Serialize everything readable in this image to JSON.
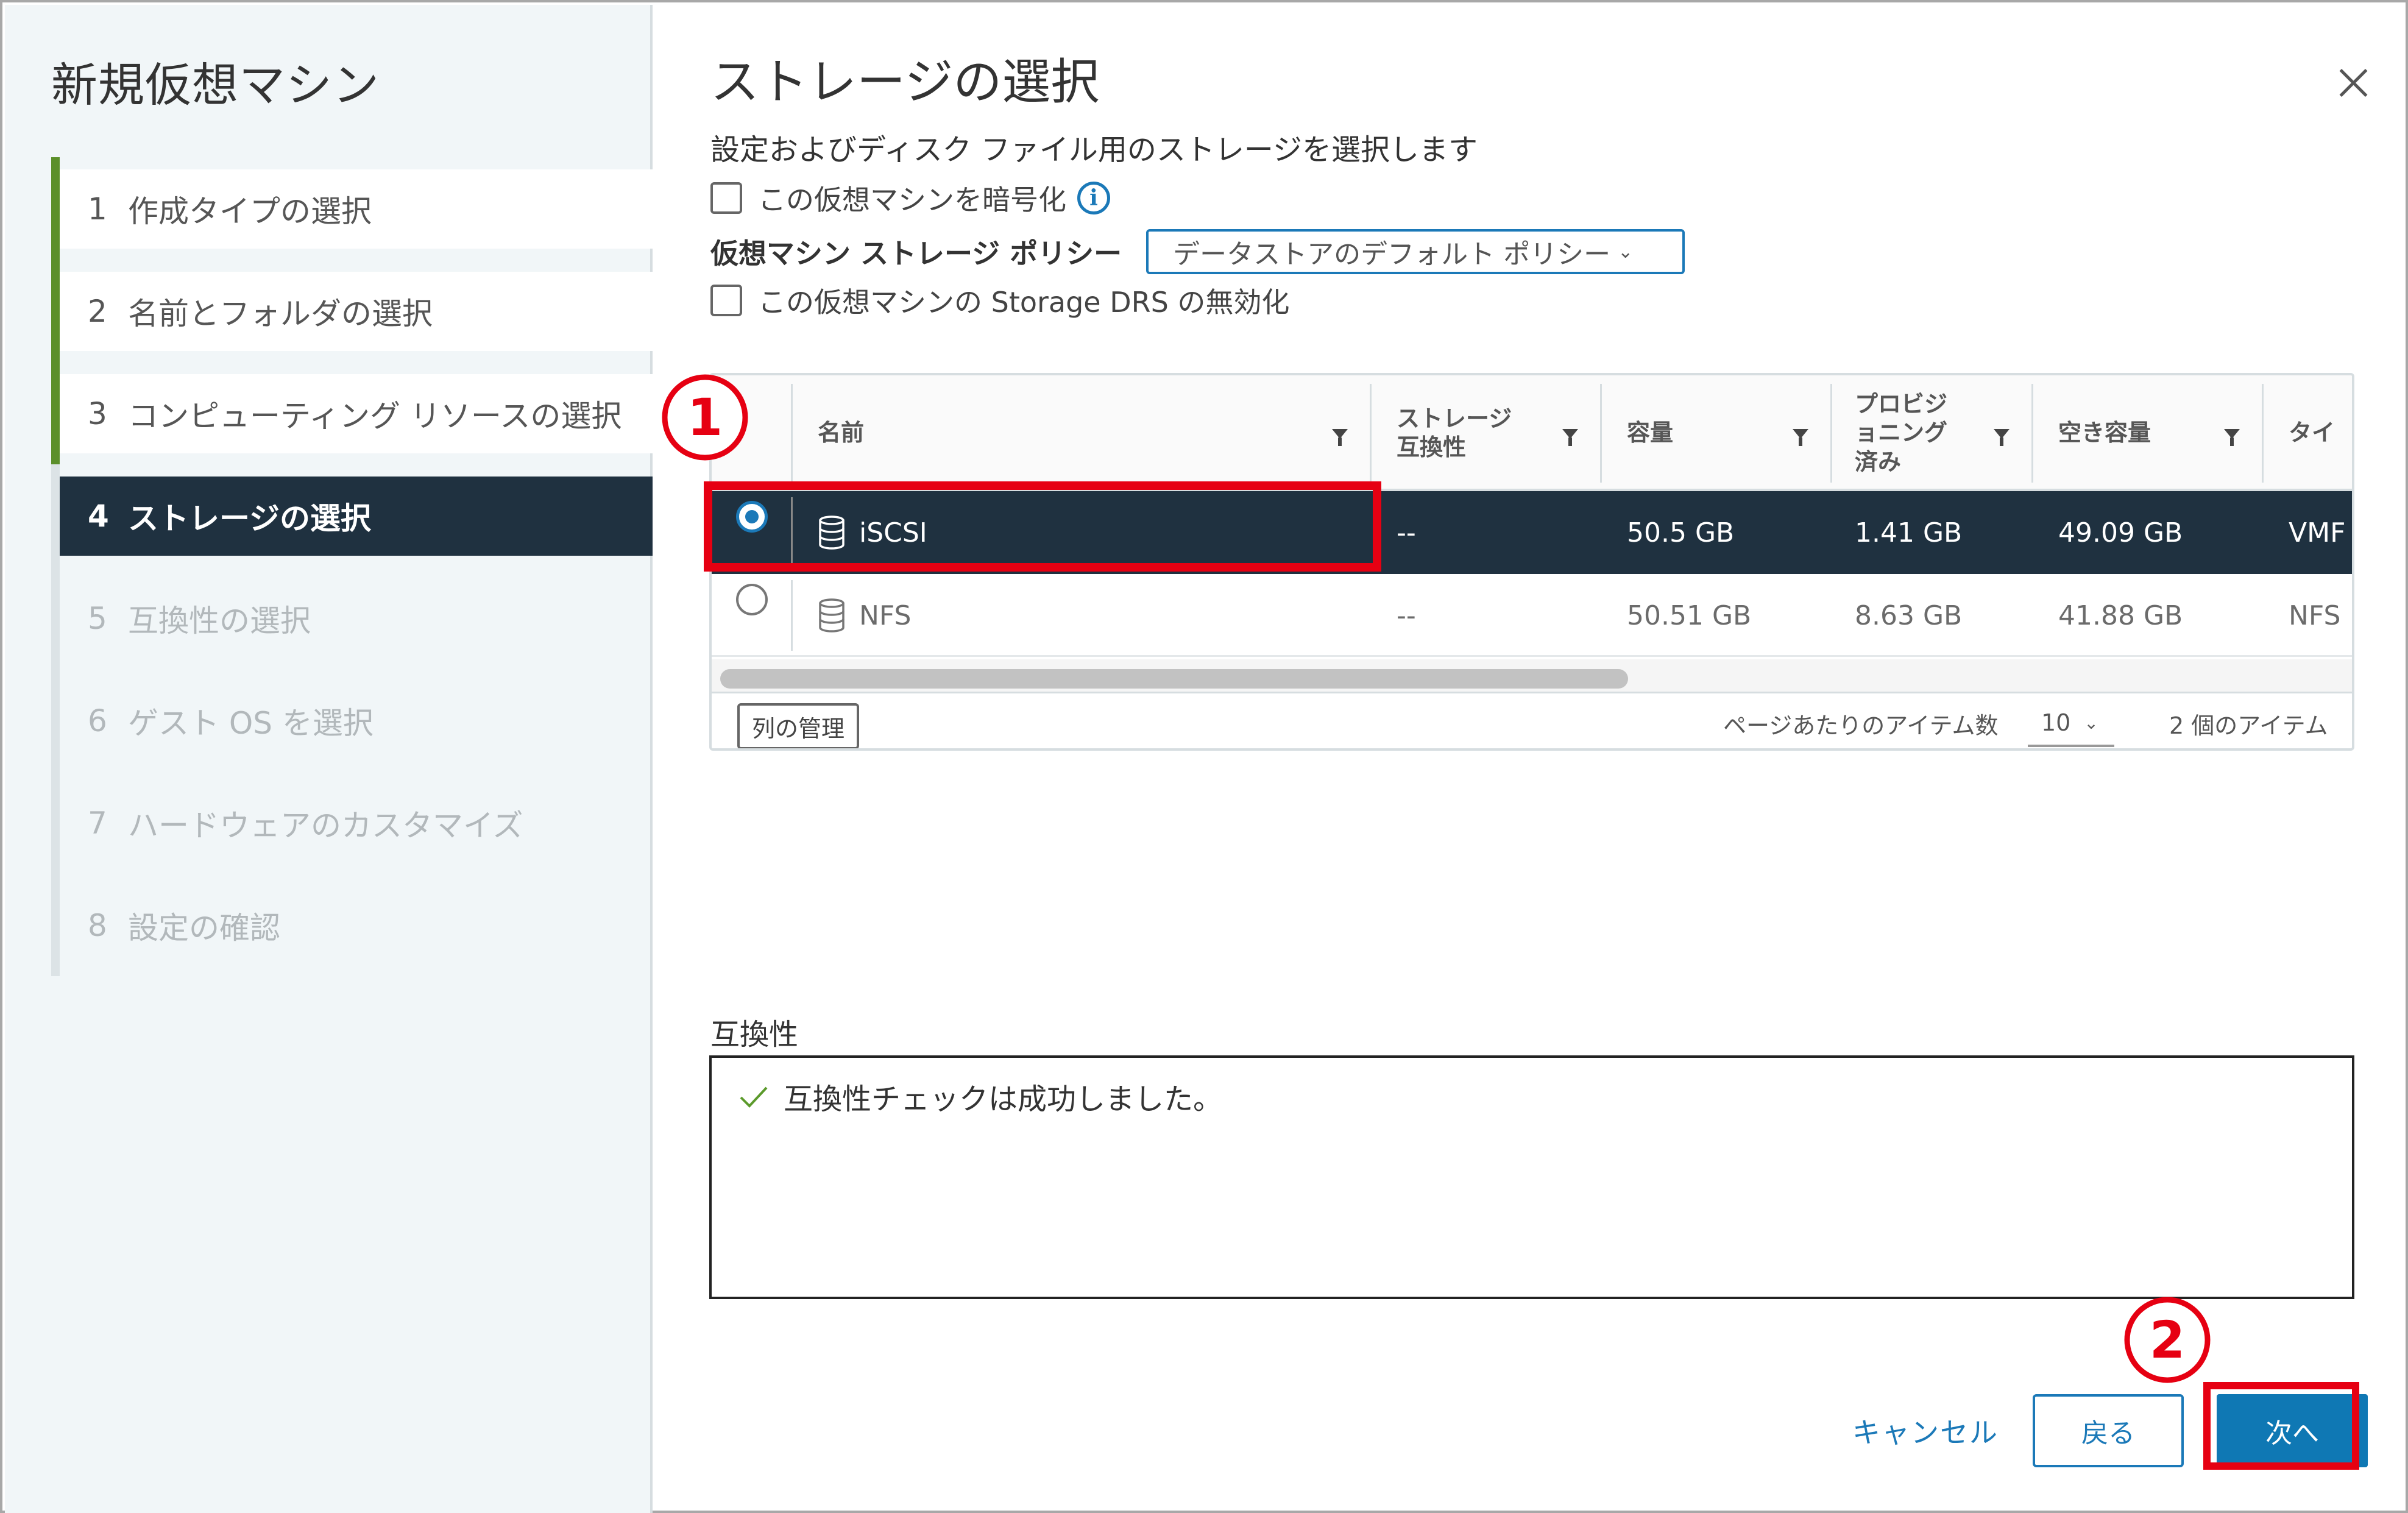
{
  "wizard": {
    "title": "新規仮想マシン",
    "steps": [
      {
        "num": "1",
        "label": "作成タイプの選択",
        "state": "done"
      },
      {
        "num": "2",
        "label": "名前とフォルダの選択",
        "state": "done"
      },
      {
        "num": "3",
        "label": "コンピューティング リソースの選択",
        "state": "done"
      },
      {
        "num": "4",
        "label": "ストレージの選択",
        "state": "active"
      },
      {
        "num": "5",
        "label": "互換性の選択",
        "state": "pending"
      },
      {
        "num": "6",
        "label": "ゲスト OS を選択",
        "state": "pending"
      },
      {
        "num": "7",
        "label": "ハードウェアのカスタマイズ",
        "state": "pending"
      },
      {
        "num": "8",
        "label": "設定の確認",
        "state": "pending"
      }
    ]
  },
  "page": {
    "title": "ストレージの選択",
    "description": "設定およびディスク ファイル用のストレージを選択します",
    "encrypt_label": "この仮想マシンを暗号化",
    "encrypt_checked": false,
    "info_icon_glyph": "i",
    "policy_label": "仮想マシン ストレージ ポリシー",
    "policy_value": "データストアのデフォルト ポリシー",
    "policy_caret": "⌄",
    "drs_label": "この仮想マシンの Storage DRS の無効化",
    "drs_checked": false
  },
  "grid": {
    "columns": [
      {
        "key": "name",
        "label": "名前"
      },
      {
        "key": "compat",
        "label": "ストレージ 互換性",
        "lines": [
          "ストレージ",
          "互換性"
        ]
      },
      {
        "key": "capacity",
        "label": "容量"
      },
      {
        "key": "provisioned",
        "label": "プロビジョニング済み",
        "lines": [
          "プロビジ",
          "ョニング",
          "済み"
        ]
      },
      {
        "key": "free",
        "label": "空き容量"
      },
      {
        "key": "type",
        "label": "タイプ",
        "visible_text": "タイ"
      }
    ],
    "rows": [
      {
        "selected": true,
        "name": "iSCSI",
        "compat": "--",
        "capacity": "50.5 GB",
        "provisioned": "1.41 GB",
        "free": "49.09 GB",
        "type": "VMF"
      },
      {
        "selected": false,
        "name": "NFS",
        "compat": "--",
        "capacity": "50.51 GB",
        "provisioned": "8.63 GB",
        "free": "41.88 GB",
        "type": "NFS"
      }
    ],
    "manage_columns_label": "列の管理",
    "per_page_label": "ページあたりのアイテム数",
    "per_page_value": "10",
    "per_page_caret": "⌄",
    "item_count": "2 個のアイテム"
  },
  "compatibility": {
    "label": "互換性",
    "message": "互換性チェックは成功しました。"
  },
  "buttons": {
    "cancel": "キャンセル",
    "back": "戻る",
    "next": "次へ"
  },
  "annotations": {
    "step1": "1",
    "step2": "2",
    "color": "#e60012"
  },
  "colors": {
    "accent": "#1b79b8",
    "primary_button": "#0f78b4",
    "selected_dark": "#1f3140",
    "step_done": "#5b8f2a",
    "success_check": "#5b9a2b"
  }
}
